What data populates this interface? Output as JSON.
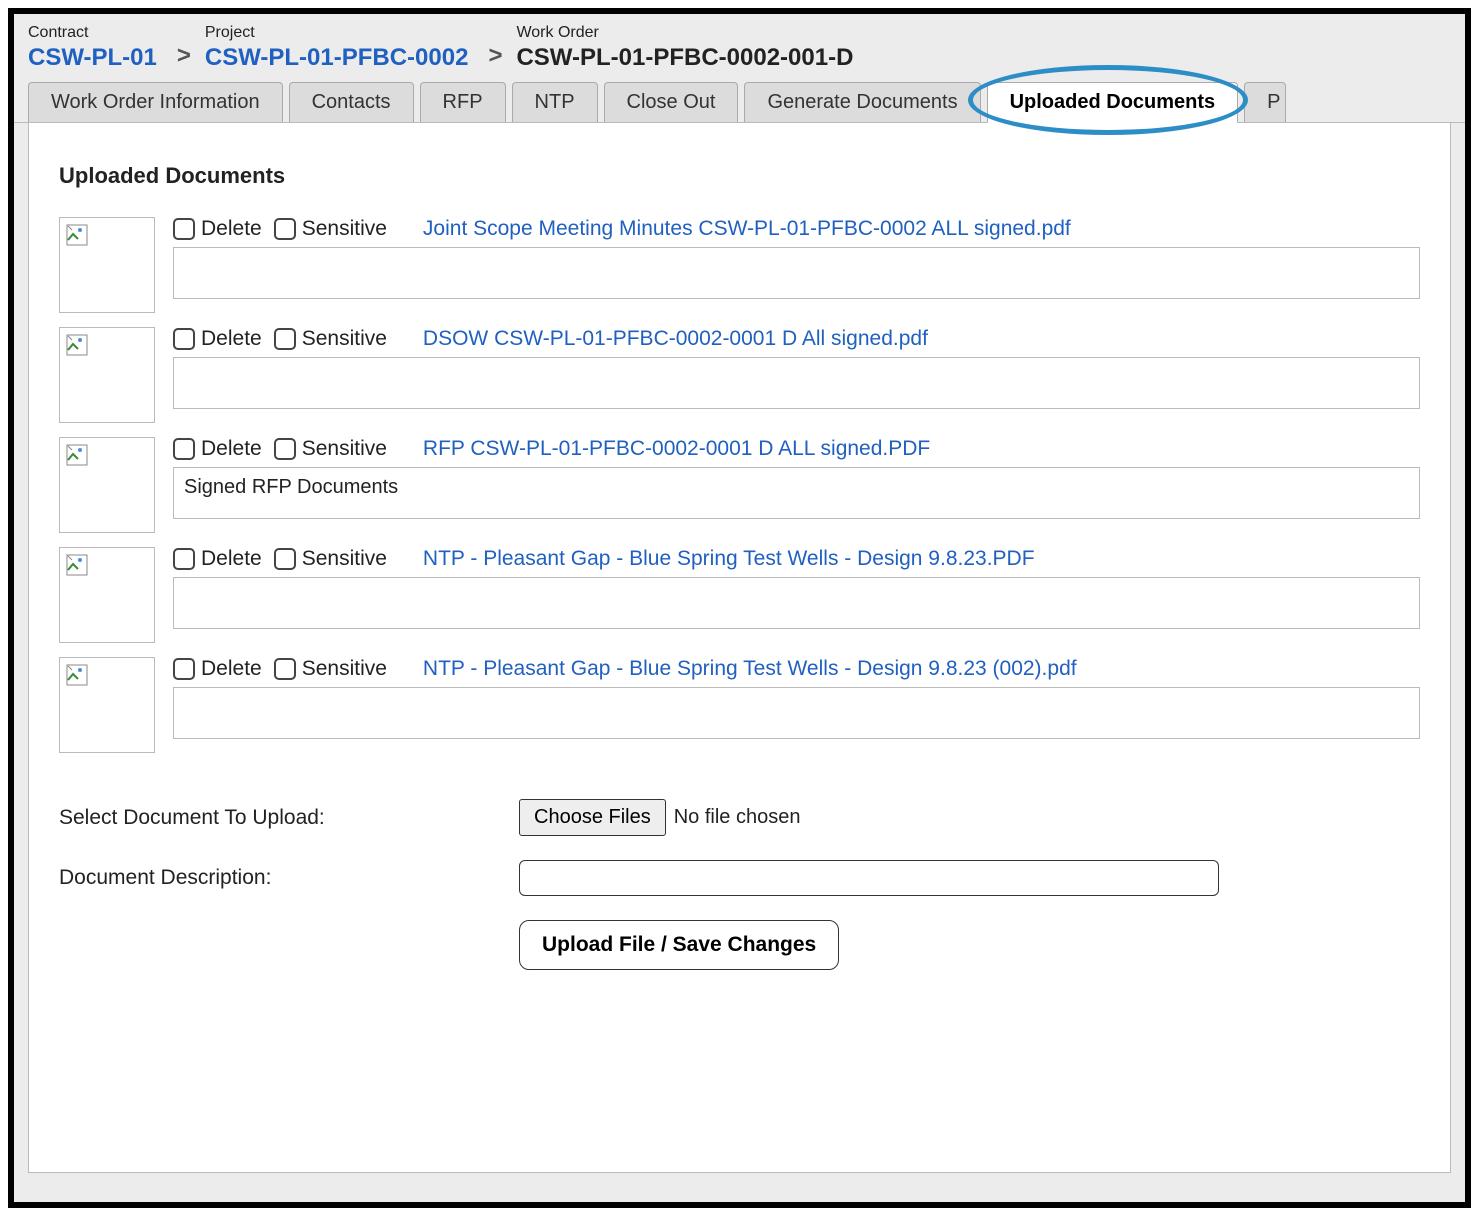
{
  "breadcrumb": {
    "contract_label": "Contract",
    "contract_value": "CSW-PL-01",
    "project_label": "Project",
    "project_value": "CSW-PL-01-PFBC-0002",
    "workorder_label": "Work Order",
    "workorder_value": "CSW-PL-01-PFBC-0002-001-D",
    "sep": ">"
  },
  "tabs": {
    "items": [
      {
        "label": "Work Order Information"
      },
      {
        "label": "Contacts"
      },
      {
        "label": "RFP"
      },
      {
        "label": "NTP"
      },
      {
        "label": "Close Out"
      },
      {
        "label": "Generate Documents"
      },
      {
        "label": "Uploaded Documents"
      }
    ],
    "active_index": 6,
    "partial_next": "P"
  },
  "section_title": "Uploaded Documents",
  "checkbox_labels": {
    "delete": "Delete",
    "sensitive": "Sensitive"
  },
  "documents": [
    {
      "filename": "Joint Scope Meeting Minutes CSW-PL-01-PFBC-0002 ALL signed.pdf",
      "description": ""
    },
    {
      "filename": "DSOW CSW-PL-01-PFBC-0002-0001 D All signed.pdf",
      "description": ""
    },
    {
      "filename": "RFP CSW-PL-01-PFBC-0002-0001 D ALL signed.PDF",
      "description": "Signed RFP Documents"
    },
    {
      "filename": "NTP - Pleasant Gap - Blue Spring Test Wells - Design 9.8.23.PDF",
      "description": ""
    },
    {
      "filename": "NTP - Pleasant Gap - Blue Spring Test Wells - Design 9.8.23 (002).pdf",
      "description": ""
    }
  ],
  "upload": {
    "select_label": "Select Document To Upload:",
    "choose_button": "Choose Files",
    "no_file_text": "No file chosen",
    "description_label": "Document Description:",
    "submit_button": "Upload File / Save Changes"
  }
}
